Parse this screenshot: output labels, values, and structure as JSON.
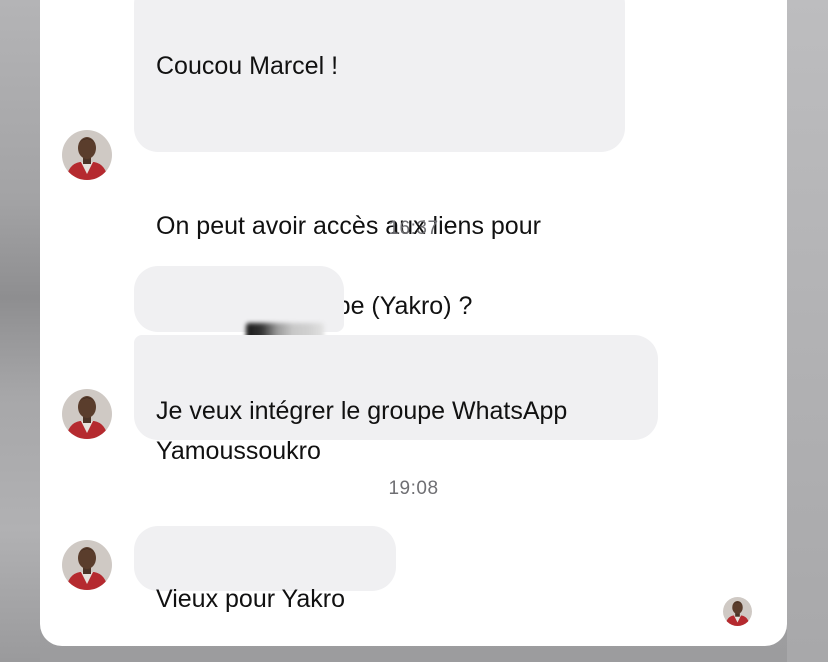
{
  "conversation": {
    "messages": [
      {
        "id": "msg-1",
        "lines": [
          "Coucou Marcel !",
          "",
          "On peut avoir accès aux liens pour",
          "rejoindre le groupe (Yakro) ?"
        ]
      },
      {
        "id": "msg-2",
        "phone_visible": "05035"
      },
      {
        "id": "msg-3",
        "text": "Je veux intégrer le groupe WhatsApp\nYamoussoukro"
      },
      {
        "id": "msg-4",
        "text": "Vieux pour Yakro"
      }
    ],
    "timestamps": [
      "16:37",
      "19:08"
    ]
  },
  "icons": {
    "avatar": "contact-avatar-icon",
    "read_receipt": "read-receipt-avatar-icon"
  },
  "colors": {
    "bubble_bg": "#f0f0f2",
    "text": "#111111",
    "timestamp": "#6f6f73",
    "panel_bg": "#ffffff",
    "avatar_jacket": "#b52a2f"
  }
}
